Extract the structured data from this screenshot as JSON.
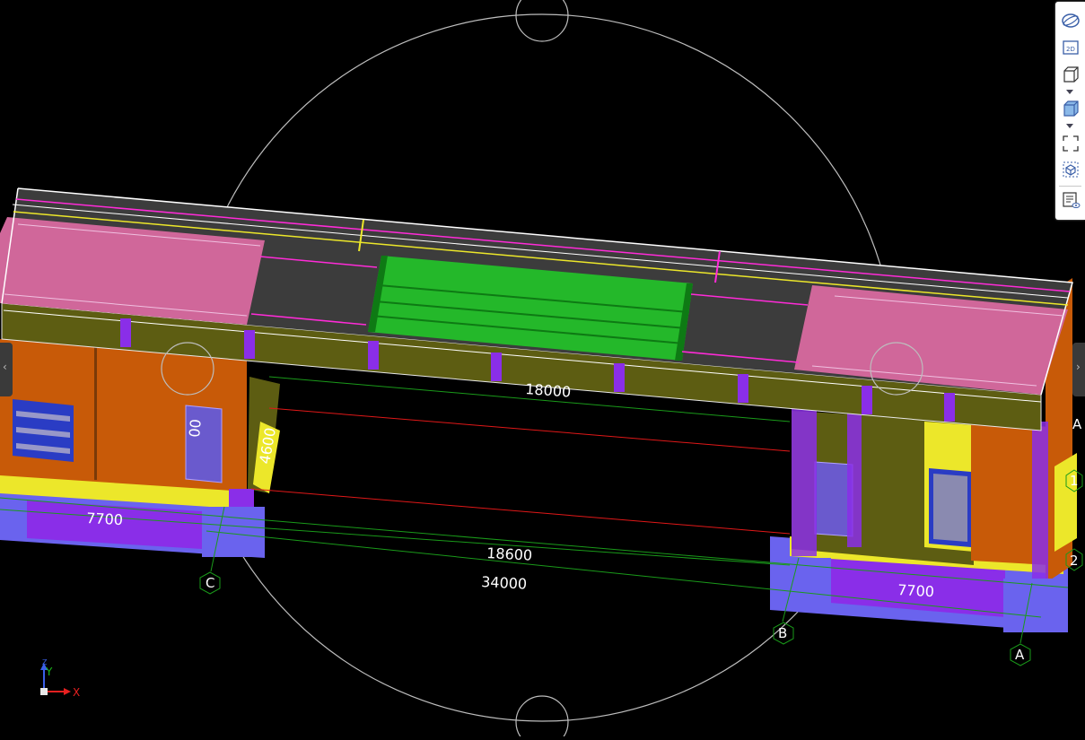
{
  "view": {
    "background": "#000000",
    "dimensions": [
      {
        "id": "top-span",
        "text": "18000"
      },
      {
        "id": "column-height",
        "text": "4600"
      },
      {
        "id": "left-partial",
        "text": "00"
      },
      {
        "id": "left-width",
        "text": "7700"
      },
      {
        "id": "right-width",
        "text": "7700"
      },
      {
        "id": "mid-span",
        "text": "18600"
      },
      {
        "id": "total-span",
        "text": "34000"
      }
    ],
    "grid_labels": {
      "c": "C",
      "b": "B",
      "a": "A",
      "g1": "1",
      "g2": "2",
      "edge": "A"
    },
    "axis": {
      "y": "Y",
      "x": "X",
      "z": "Z"
    }
  },
  "toolbar": {
    "items": [
      {
        "icon": "orbit-icon"
      },
      {
        "icon": "view-2d-icon",
        "label": "2D"
      },
      {
        "icon": "view-box-icon"
      },
      {
        "icon": "view-shaded-box-icon"
      },
      {
        "icon": "fit-view-icon"
      },
      {
        "icon": "object-icon"
      },
      {
        "icon": "properties-icon"
      }
    ]
  },
  "colors": {
    "pink": "#d0679a",
    "green": "#24b82a",
    "olive": "#5d5d12",
    "orange": "#c85a08",
    "purple": "#8a2ee8",
    "blue": "#6a63ee",
    "yellow": "#ece72a"
  }
}
